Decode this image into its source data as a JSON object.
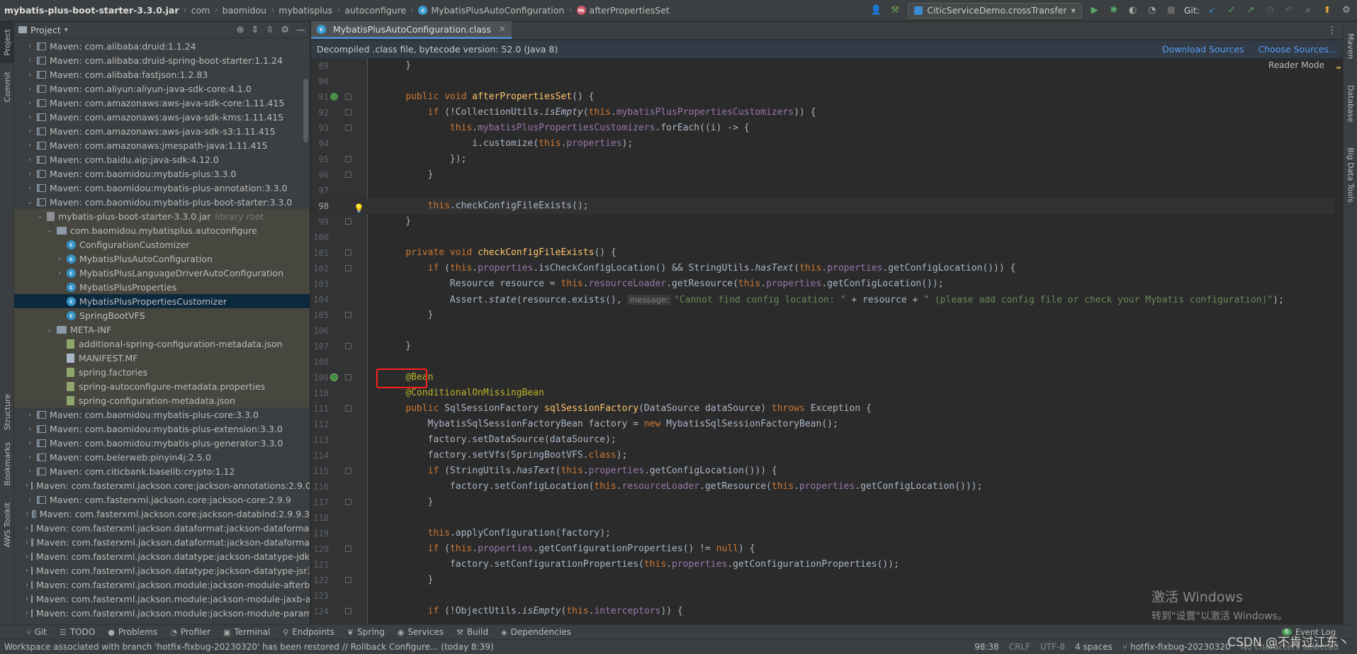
{
  "breadcrumbs": [
    "mybatis-plus-boot-starter-3.3.0.jar",
    "com",
    "baomidou",
    "mybatisplus",
    "autoconfigure",
    "MybatisPlusAutoConfiguration",
    "afterPropertiesSet"
  ],
  "run_config": "CiticServiceDemo.crossTransfer",
  "git_label": "Git:",
  "project_panel": {
    "title": "Project",
    "tree": [
      {
        "label": "Maven: com.alibaba:druid:1.1.24",
        "type": "lib",
        "indent": 0
      },
      {
        "label": "Maven: com.alibaba:druid-spring-boot-starter:1.1.24",
        "type": "lib",
        "indent": 0
      },
      {
        "label": "Maven: com.alibaba:fastjson:1.2.83",
        "type": "lib",
        "indent": 0
      },
      {
        "label": "Maven: com.aliyun:aliyun-java-sdk-core:4.1.0",
        "type": "lib",
        "indent": 0
      },
      {
        "label": "Maven: com.amazonaws:aws-java-sdk-core:1.11.415",
        "type": "lib",
        "indent": 0
      },
      {
        "label": "Maven: com.amazonaws:aws-java-sdk-kms:1.11.415",
        "type": "lib",
        "indent": 0
      },
      {
        "label": "Maven: com.amazonaws:aws-java-sdk-s3:1.11.415",
        "type": "lib",
        "indent": 0
      },
      {
        "label": "Maven: com.amazonaws:jmespath-java:1.11.415",
        "type": "lib",
        "indent": 0
      },
      {
        "label": "Maven: com.baidu.aip:java-sdk:4.12.0",
        "type": "lib",
        "indent": 0
      },
      {
        "label": "Maven: com.baomidou:mybatis-plus:3.3.0",
        "type": "lib",
        "indent": 0
      },
      {
        "label": "Maven: com.baomidou:mybatis-plus-annotation:3.3.0",
        "type": "lib",
        "indent": 0
      },
      {
        "label": "Maven: com.baomidou:mybatis-plus-boot-starter:3.3.0",
        "type": "lib",
        "indent": 0,
        "expanded": true
      },
      {
        "label": "mybatis-plus-boot-starter-3.3.0.jar",
        "suffix": "library root",
        "type": "jar",
        "indent": 1,
        "expanded": true,
        "hl": true
      },
      {
        "label": "com.baomidou.mybatisplus.autoconfigure",
        "type": "pkg",
        "indent": 2,
        "expanded": true,
        "hl": true
      },
      {
        "label": "ConfigurationCustomizer",
        "type": "class",
        "indent": 3,
        "hl": true
      },
      {
        "label": "MybatisPlusAutoConfiguration",
        "type": "class",
        "indent": 3,
        "collapsed": true,
        "hl": true
      },
      {
        "label": "MybatisPlusLanguageDriverAutoConfiguration",
        "type": "class",
        "indent": 3,
        "collapsed": true,
        "hl": true
      },
      {
        "label": "MybatisPlusProperties",
        "type": "class",
        "indent": 3,
        "hl": true
      },
      {
        "label": "MybatisPlusPropertiesCustomizer",
        "type": "class",
        "indent": 3,
        "selected": true
      },
      {
        "label": "SpringBootVFS",
        "type": "class",
        "indent": 3,
        "hl": true
      },
      {
        "label": "META-INF",
        "type": "pkg",
        "indent": 2,
        "expanded": true,
        "hl": true
      },
      {
        "label": "additional-spring-configuration-metadata.json",
        "type": "json",
        "indent": 3,
        "hl": true
      },
      {
        "label": "MANIFEST.MF",
        "type": "file",
        "indent": 3,
        "hl": true
      },
      {
        "label": "spring.factories",
        "type": "props",
        "indent": 3,
        "hl": true
      },
      {
        "label": "spring-autoconfigure-metadata.properties",
        "type": "props",
        "indent": 3,
        "hl": true
      },
      {
        "label": "spring-configuration-metadata.json",
        "type": "json",
        "indent": 3,
        "hl": true
      },
      {
        "label": "Maven: com.baomidou:mybatis-plus-core:3.3.0",
        "type": "lib",
        "indent": 0
      },
      {
        "label": "Maven: com.baomidou:mybatis-plus-extension:3.3.0",
        "type": "lib",
        "indent": 0
      },
      {
        "label": "Maven: com.baomidou:mybatis-plus-generator:3.3.0",
        "type": "lib",
        "indent": 0
      },
      {
        "label": "Maven: com.belerweb:pinyin4j:2.5.0",
        "type": "lib",
        "indent": 0
      },
      {
        "label": "Maven: com.citicbank.baselib:crypto:1.12",
        "type": "lib",
        "indent": 0
      },
      {
        "label": "Maven: com.fasterxml.jackson.core:jackson-annotations:2.9.0",
        "type": "lib",
        "indent": 0
      },
      {
        "label": "Maven: com.fasterxml.jackson.core:jackson-core:2.9.9",
        "type": "lib",
        "indent": 0
      },
      {
        "label": "Maven: com.fasterxml.jackson.core:jackson-databind:2.9.9.3",
        "type": "lib",
        "indent": 0
      },
      {
        "label": "Maven: com.fasterxml.jackson.dataformat:jackson-dataformat",
        "type": "lib",
        "indent": 0
      },
      {
        "label": "Maven: com.fasterxml.jackson.dataformat:jackson-dataforma",
        "type": "lib",
        "indent": 0
      },
      {
        "label": "Maven: com.fasterxml.jackson.datatype:jackson-datatype-jdk",
        "type": "lib",
        "indent": 0
      },
      {
        "label": "Maven: com.fasterxml.jackson.datatype:jackson-datatype-jsr3",
        "type": "lib",
        "indent": 0
      },
      {
        "label": "Maven: com.fasterxml.jackson.module:jackson-module-afterb",
        "type": "lib",
        "indent": 0
      },
      {
        "label": "Maven: com.fasterxml.jackson.module:jackson-module-jaxb-a",
        "type": "lib",
        "indent": 0
      },
      {
        "label": "Maven: com.fasterxml.jackson.module:jackson-module-param",
        "type": "lib",
        "indent": 0
      }
    ]
  },
  "left_strip": [
    "Project",
    "Commit",
    "Structure",
    "Bookmarks",
    "AWS Toolkit"
  ],
  "right_strip": [
    "Maven",
    "Database",
    "Big Data Tools"
  ],
  "editor_tab": "MybatisPlusAutoConfiguration.class",
  "banner": {
    "text": "Decompiled .class file, bytecode version: 52.0 (Java 8)",
    "download_sources": "Download Sources",
    "choose_sources": "Choose Sources..."
  },
  "reader_mode": "Reader Mode",
  "code_lines": [
    {
      "n": "89",
      "html": "    }"
    },
    {
      "n": "90",
      "html": ""
    },
    {
      "n": "91",
      "html": "    <span class=\"kw\">public void</span> <span class=\"fn\">afterPropertiesSet</span>() {",
      "gutter": "over"
    },
    {
      "n": "92",
      "html": "        <span class=\"kw\">if</span> (!CollectionUtils.<span class=\"it\">isEmpty</span>(<span class=\"kw\">this</span>.<span class=\"fld\">mybatisPlusPropertiesCustomizers</span>)) {"
    },
    {
      "n": "93",
      "html": "            <span class=\"kw\">this</span>.<span class=\"fld\">mybatisPlusPropertiesCustomizers</span>.forEach((i) -&gt; {"
    },
    {
      "n": "94",
      "html": "                i.customize(<span class=\"kw\">this</span>.<span class=\"fld\">properties</span>);"
    },
    {
      "n": "95",
      "html": "            });"
    },
    {
      "n": "96",
      "html": "        }"
    },
    {
      "n": "97",
      "html": ""
    },
    {
      "n": "98",
      "html": "        <span class=\"kw\">this</span>.checkConfigFileExists();",
      "current": true,
      "bulb": true
    },
    {
      "n": "99",
      "html": "    }"
    },
    {
      "n": "100",
      "html": ""
    },
    {
      "n": "101",
      "html": "    <span class=\"kw\">private void</span> <span class=\"fn\">checkConfigFileExists</span>() {"
    },
    {
      "n": "102",
      "html": "        <span class=\"kw\">if</span> (<span class=\"kw\">this</span>.<span class=\"fld\">properties</span>.isCheckConfigLocation() &amp;&amp; StringUtils.<span class=\"it\">hasText</span>(<span class=\"kw\">this</span>.<span class=\"fld\">properties</span>.getConfigLocation())) {"
    },
    {
      "n": "103",
      "html": "            Resource resource = <span class=\"kw\">this</span>.<span class=\"fld\">resourceLoader</span>.getResource(<span class=\"kw\">this</span>.<span class=\"fld\">properties</span>.getConfigLocation());"
    },
    {
      "n": "104",
      "html": "            Assert.<span class=\"it\">state</span>(resource.exists(), <span class=\"hint\">message:</span><span class=\"str\">\"Cannot find config location: \"</span> + resource + <span class=\"str\">\" (please add config file or check your Mybatis configuration)\"</span>);"
    },
    {
      "n": "105",
      "html": "        }"
    },
    {
      "n": "106",
      "html": ""
    },
    {
      "n": "107",
      "html": "    }"
    },
    {
      "n": "108",
      "html": ""
    },
    {
      "n": "109",
      "html": "    <span class=\"ann\">@Bean</span>",
      "gutter": "bean"
    },
    {
      "n": "110",
      "html": "    <span class=\"ann\">@ConditionalOnMissingBean</span>"
    },
    {
      "n": "111",
      "html": "    <span class=\"kw\">public</span> SqlSessionFactory <span class=\"fn\">sqlSessionFactory</span>(DataSource dataSource) <span class=\"kw\">throws</span> Exception {"
    },
    {
      "n": "112",
      "html": "        MybatisSqlSessionFactoryBean factory = <span class=\"kw\">new</span> MybatisSqlSessionFactoryBean();"
    },
    {
      "n": "113",
      "html": "        factory.setDataSource(dataSource);"
    },
    {
      "n": "114",
      "html": "        factory.setVfs(SpringBootVFS.<span class=\"kw\">class</span>);"
    },
    {
      "n": "115",
      "html": "        <span class=\"kw\">if</span> (StringUtils.<span class=\"it\">hasText</span>(<span class=\"kw\">this</span>.<span class=\"fld\">properties</span>.getConfigLocation())) {"
    },
    {
      "n": "116",
      "html": "            factory.setConfigLocation(<span class=\"kw\">this</span>.<span class=\"fld\">resourceLoader</span>.getResource(<span class=\"kw\">this</span>.<span class=\"fld\">properties</span>.getConfigLocation()));"
    },
    {
      "n": "117",
      "html": "        }"
    },
    {
      "n": "118",
      "html": ""
    },
    {
      "n": "119",
      "html": "        <span class=\"kw\">this</span>.applyConfiguration(factory);"
    },
    {
      "n": "120",
      "html": "        <span class=\"kw\">if</span> (<span class=\"kw\">this</span>.<span class=\"fld\">properties</span>.getConfigurationProperties() != <span class=\"kw\">null</span>) {"
    },
    {
      "n": "121",
      "html": "            factory.setConfigurationProperties(<span class=\"kw\">this</span>.<span class=\"fld\">properties</span>.getConfigurationProperties());"
    },
    {
      "n": "122",
      "html": "        }"
    },
    {
      "n": "123",
      "html": ""
    },
    {
      "n": "124",
      "html": "        <span class=\"kw\">if</span> (!ObjectUtils.<span class=\"it\">isEmpty</span>(<span class=\"kw\">this</span>.<span class=\"fld\">interceptors</span>)) {"
    }
  ],
  "activate_windows": {
    "line1": "激活 Windows",
    "line2": "转到\"设置\"以激活 Windows。"
  },
  "bottom_tabs": [
    {
      "icon": "git-icon",
      "glyph": "⑂",
      "label": "Git"
    },
    {
      "icon": "todo-icon",
      "glyph": "☰",
      "label": "TODO"
    },
    {
      "icon": "problems-icon",
      "glyph": "●",
      "label": "Problems"
    },
    {
      "icon": "profiler-icon",
      "glyph": "◔",
      "label": "Profiler"
    },
    {
      "icon": "terminal-icon",
      "glyph": "▣",
      "label": "Terminal"
    },
    {
      "icon": "endpoints-icon",
      "glyph": "⚲",
      "label": "Endpoints"
    },
    {
      "icon": "spring-icon",
      "glyph": "❦",
      "label": "Spring"
    },
    {
      "icon": "services-icon",
      "glyph": "◉",
      "label": "Services"
    },
    {
      "icon": "build-icon",
      "glyph": "⚒",
      "label": "Build"
    },
    {
      "icon": "dependencies-icon",
      "glyph": "◈",
      "label": "Dependencies"
    }
  ],
  "event_log": {
    "count": "6",
    "label": "Event Log"
  },
  "status": {
    "message": "Workspace associated with branch 'hotfix-fixbug-20230320' has been restored // Rollback   Configure... (today 8:39)",
    "position": "98:38",
    "line_sep": "CRLF",
    "encoding": "UTF-8",
    "indent": "4 spaces",
    "branch": "hotfix-fixbug-20230320",
    "selection": "No characters selected"
  },
  "watermark": "CSDN @不肯过江东丶"
}
